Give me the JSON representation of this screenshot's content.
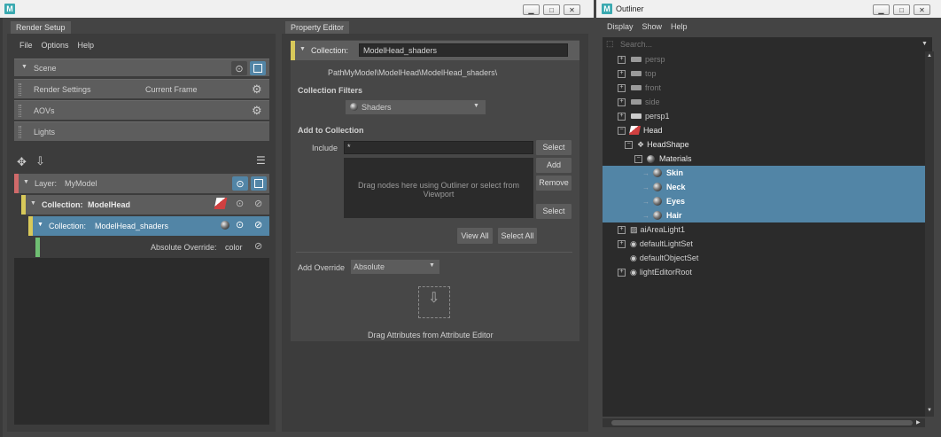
{
  "render_setup_window": {
    "tab": "Render Setup",
    "menu": [
      "File",
      "Options",
      "Help"
    ],
    "scene": {
      "label": "Scene",
      "items": [
        {
          "label": "Render Settings",
          "extra": "Current Frame"
        },
        {
          "label": "AOVs"
        },
        {
          "label": "Lights"
        }
      ]
    },
    "layer": {
      "prefix": "Layer:",
      "name": "MyModel"
    },
    "collection1": {
      "prefix": "Collection:",
      "name": "ModelHead"
    },
    "collection2": {
      "prefix": "Collection:",
      "name": "ModelHead_shaders"
    },
    "override": {
      "label": "Absolute Override:",
      "value": "color"
    }
  },
  "property_editor": {
    "tab": "Property Editor",
    "collection_label": "Collection:",
    "collection_name": "ModelHead_shaders",
    "path_label": "Path",
    "path_value": "MyModel\\ModelHead\\ModelHead_shaders\\",
    "filters_heading": "Collection Filters",
    "filter_value": "Shaders",
    "add_heading": "Add to Collection",
    "include_label": "Include",
    "include_value": "*",
    "drop_hint": "Drag nodes here using Outliner or select from Viewport",
    "buttons": {
      "select_top": "Select",
      "add": "Add",
      "remove": "Remove",
      "select_bottom": "Select",
      "view_all": "View All",
      "select_all": "Select All"
    },
    "add_override_label": "Add Override",
    "add_override_value": "Absolute",
    "drag_attr_hint": "Drag Attributes from Attribute Editor"
  },
  "outliner": {
    "title": "Outliner",
    "menu": [
      "Display",
      "Show",
      "Help"
    ],
    "search_placeholder": "Search...",
    "cameras": [
      "persp",
      "top",
      "front",
      "side",
      "persp1"
    ],
    "head": "Head",
    "head_shape": "HeadShape",
    "materials": "Materials",
    "shaders": [
      "Skin",
      "Neck",
      "Eyes",
      "Hair"
    ],
    "others": [
      "aiAreaLight1",
      "defaultLightSet",
      "defaultObjectSet",
      "lightEditorRoot"
    ]
  },
  "colors": {
    "selection": "#5285a6",
    "accent_yellow": "#d8c95a",
    "accent_green": "#6fbf73",
    "accent_red": "#d06a6a"
  }
}
